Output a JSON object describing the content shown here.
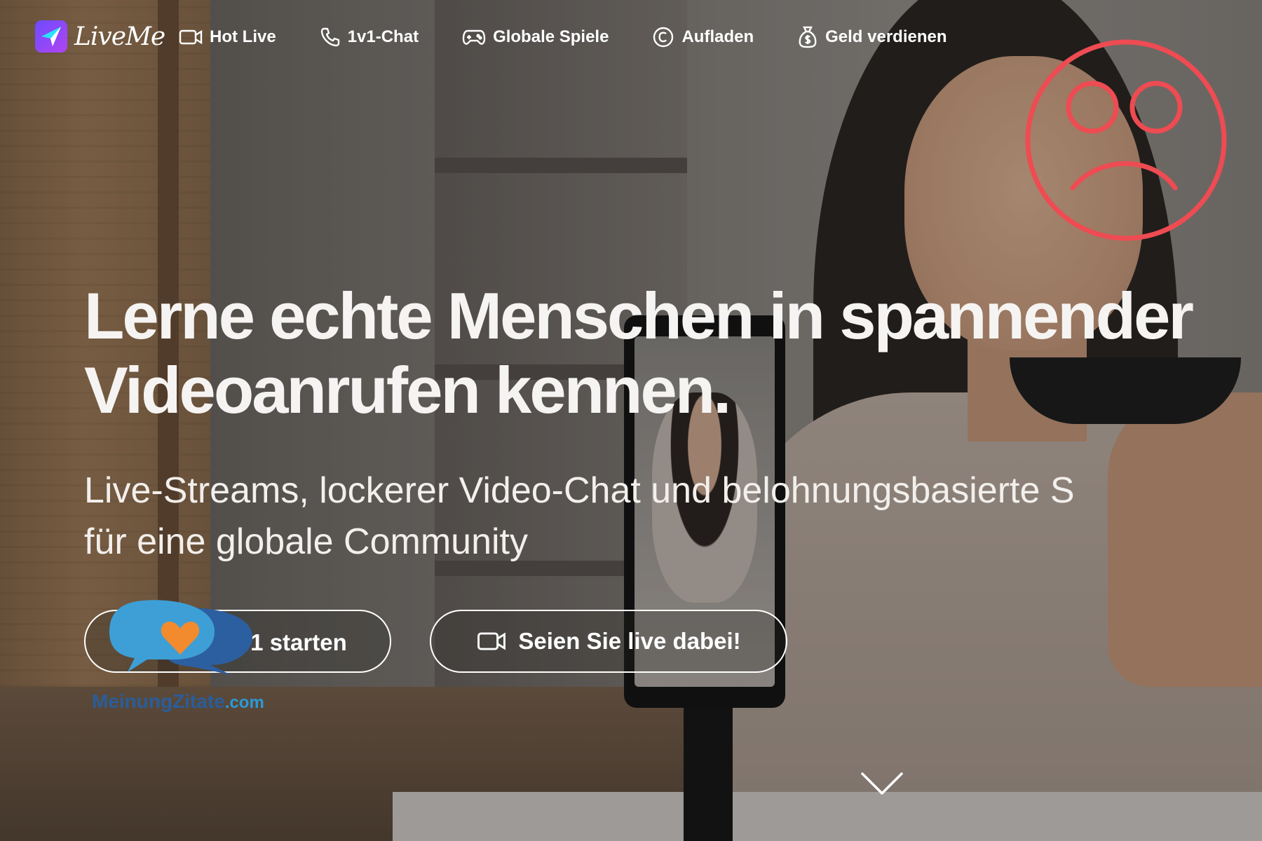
{
  "brand": {
    "name": "LiveMe"
  },
  "nav": [
    {
      "label": "Hot Live",
      "icon": "video-camera-icon"
    },
    {
      "label": "1v1-Chat",
      "icon": "phone-icon"
    },
    {
      "label": "Globale Spiele",
      "icon": "gamepad-icon"
    },
    {
      "label": "Aufladen",
      "icon": "coin-icon"
    },
    {
      "label": "Geld verdienen",
      "icon": "money-bag-icon"
    }
  ],
  "hero": {
    "title_line1": "Lerne echte Menschen in spannender",
    "title_line2": "Videoanrufen kennen.",
    "subtitle_line1": "Live-Streams, lockerer Video-Chat und belohnungsbasierte S",
    "subtitle_line2": "für eine globale Community"
  },
  "cta": {
    "call_label": "/1 starten",
    "live_label": "Seien Sie live dabei!"
  },
  "watermark": {
    "name": "MeinungZitate",
    "tld": ".com"
  },
  "colors": {
    "brand_gradient": [
      "#6c4cff",
      "#b144f0"
    ],
    "sad_face": "#ee4b52",
    "watermark_heart": "#f28a2e",
    "watermark_bubble": "#3e8fc9"
  }
}
